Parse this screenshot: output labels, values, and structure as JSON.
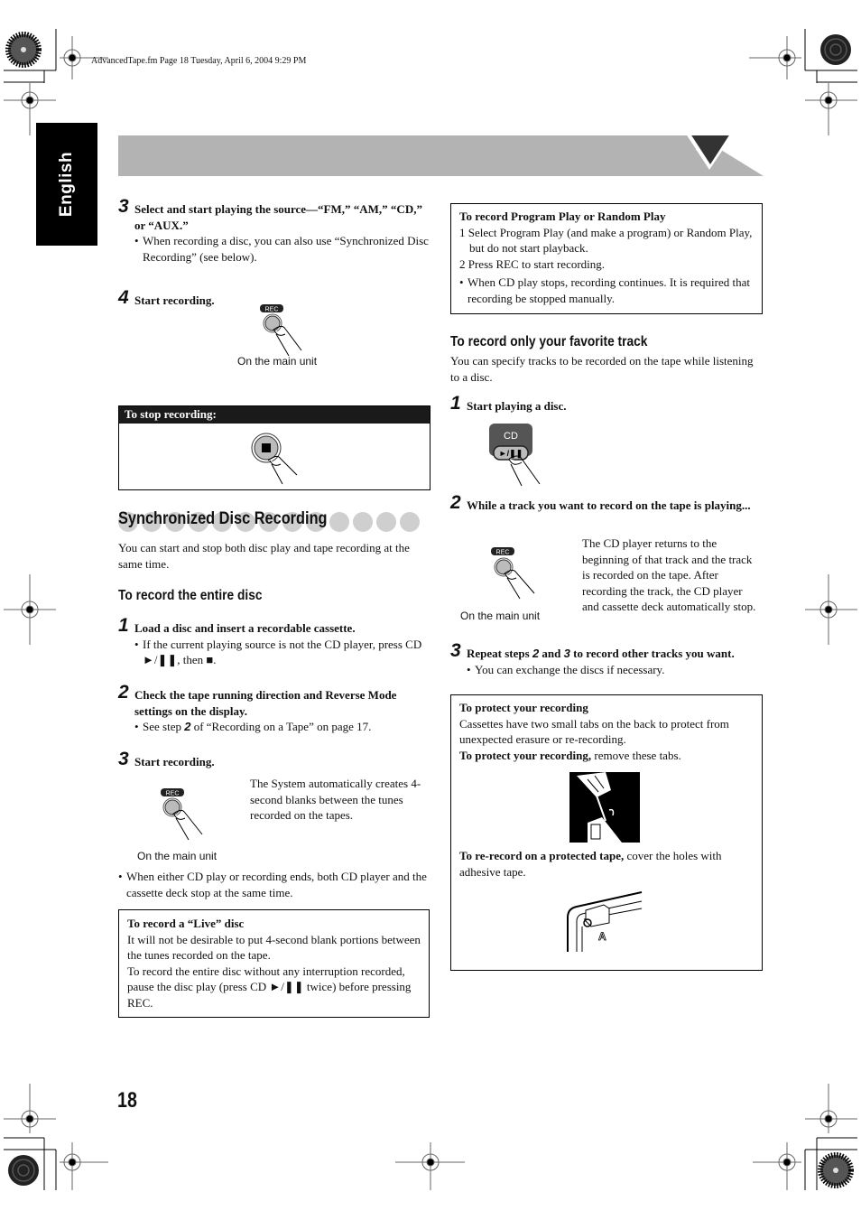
{
  "print_header": "AdvancedTape.fm  Page 18  Tuesday, April 6, 2004  9:29 PM",
  "language_tab": "English",
  "page_number": "18",
  "left_column": {
    "step3_source": {
      "num": "3",
      "title": "Select and start playing the source—“FM,” “AM,” “CD,” or “AUX.”",
      "bullet": "When recording a disc, you can also use “Synchronized Disc Recording” (see below)."
    },
    "step4_record": {
      "num": "4",
      "title": "Start recording.",
      "button_label": "REC",
      "caption": "On the main unit"
    },
    "stop_box": {
      "title": "To stop recording:",
      "button_icon": "stop-icon"
    },
    "sync_section": {
      "title": "Synchronized Disc Recording",
      "intro": "You can start and stop both disc play and tape recording at the same time."
    },
    "entire_disc": {
      "heading": "To record the entire disc",
      "steps": [
        {
          "num": "1",
          "title": "Load a disc and insert a recordable cassette.",
          "bullet": "If the current playing source is not the CD player, press CD ►/❚❚, then ■."
        },
        {
          "num": "2",
          "title": "Check the tape running direction and Reverse Mode settings on the display.",
          "bullet_pre": "See step ",
          "bullet_ref": "2",
          "bullet_post": " of “Recording on a Tape” on page 17."
        },
        {
          "num": "3",
          "title": "Start recording.",
          "button_label": "REC",
          "caption": "On the main unit",
          "side_text": "The System automatically creates 4-second blanks between the tunes recorded on the tapes."
        }
      ],
      "after_bullet": "When either CD play or recording ends, both CD player and the cassette deck stop at the same time."
    },
    "live_box": {
      "title": "To record a “Live” disc",
      "lines": [
        "It will not be desirable to put 4-second blank portions between the tunes recorded on the tape.",
        "To record the entire disc without any interruption recorded, pause the disc play (press CD ►/❚❚ twice) before pressing REC."
      ]
    }
  },
  "right_column": {
    "program_box": {
      "title": "To record Program Play or Random Play",
      "items": [
        "1 Select Program Play (and make a program) or Random Play, but do not start playback.",
        "2 Press REC to start recording."
      ],
      "bullet": "When CD play stops, recording continues. It is required that recording be stopped manually."
    },
    "favorite": {
      "heading": "To record only your favorite track",
      "intro": "You can specify tracks to be recorded on the tape while listening to a disc.",
      "steps": [
        {
          "num": "1",
          "title": "Start playing a disc.",
          "button_top": "CD",
          "button_label": "►/❚❚"
        },
        {
          "num": "2",
          "title": "While a track you want to record on the tape is playing...",
          "button_label": "REC",
          "caption": "On the main unit",
          "side_text": "The CD player returns to the beginning of that track and the track is recorded on the tape. After recording the track, the CD player and cassette deck automatically stop."
        },
        {
          "num": "3",
          "title_pre": "Repeat steps ",
          "ref1": "2",
          "title_mid": " and ",
          "ref2": "3",
          "title_post": " to record other tracks you want.",
          "bullet": "You can exchange the discs if necessary."
        }
      ]
    },
    "protect_box": {
      "title": "To protect your recording",
      "text": "Cassettes have two small tabs on the back to protect from unexpected erasure or re-recording.",
      "protect_bold": "To protect your recording,",
      "protect_rest": " remove these tabs.",
      "rerecord_bold": "To re-record on a protected tape,",
      "rerecord_rest": " cover the holes with adhesive tape.",
      "cassette_side_label": "A"
    }
  },
  "colors": {
    "banner_gray": "#b3b3b3",
    "banner_triangle": "#333333",
    "dot_gray": "#cfcfcf",
    "tab_black": "#000000"
  }
}
